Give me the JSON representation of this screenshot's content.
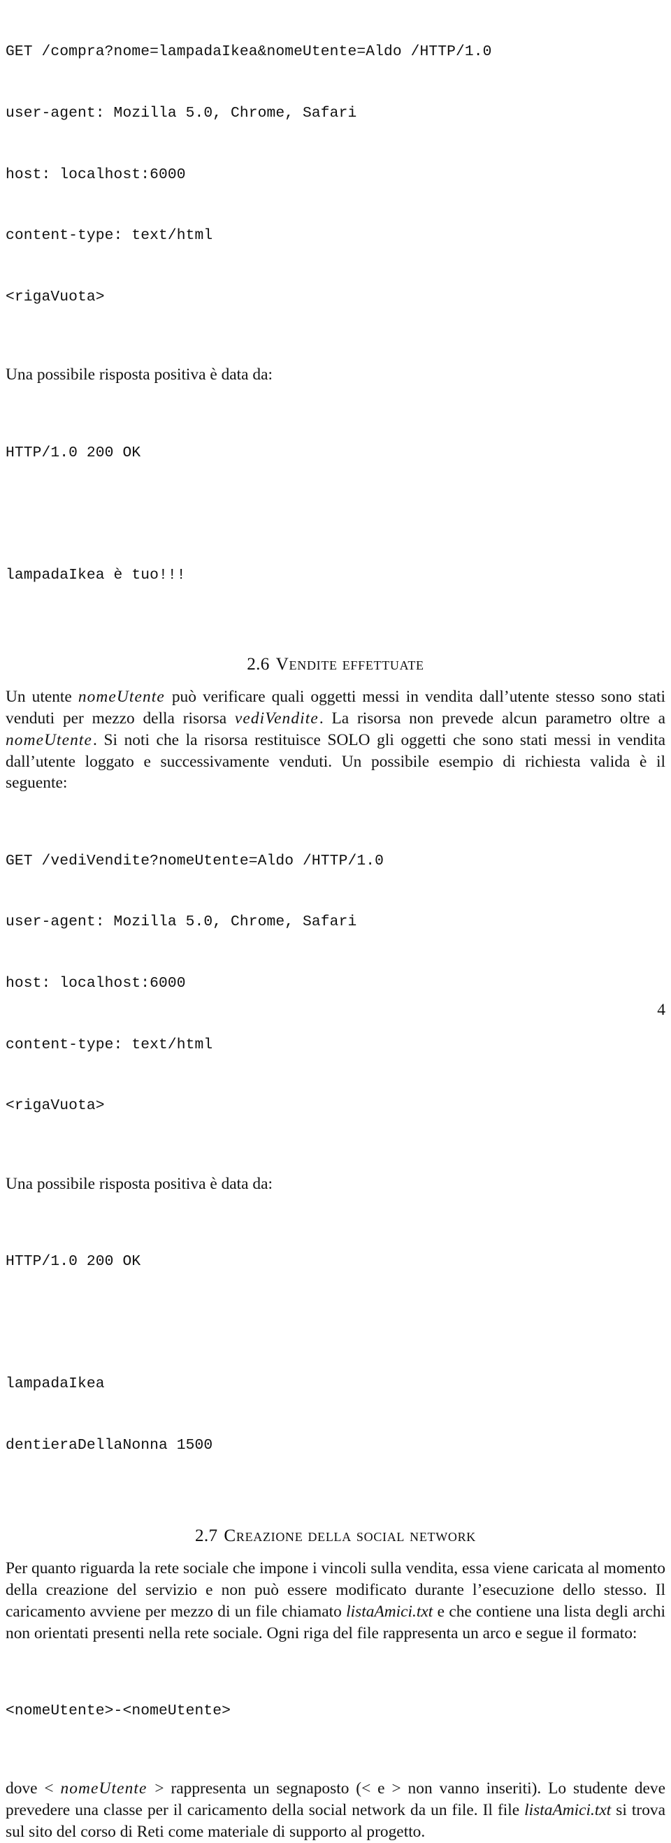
{
  "page": {
    "number": "4",
    "background_color": "#ffffff",
    "text_color": "#121212"
  },
  "blocks": {
    "request_compra": {
      "lines": [
        "GET /compra?nome=lampadaIkea&nomeUtente=Aldo /HTTP/1.0",
        "user-agent: Mozilla 5.0, Chrome, Safari",
        "host: localhost:6000",
        "content-type: text/html",
        "<rigaVuota>"
      ]
    },
    "intro_response_1": "Una possibile risposta positiva è data da:",
    "response_compra_status": "HTTP/1.0 200 OK",
    "response_compra_body": "lampadaIkea è tuo!!!",
    "request_vedivendite": {
      "lines": [
        "GET /vediVendite?nomeUtente=Aldo /HTTP/1.0",
        "user-agent: Mozilla 5.0, Chrome, Safari",
        "host: localhost:6000",
        "content-type: text/html",
        "<rigaVuota>"
      ]
    },
    "intro_response_2": "Una possibile risposta positiva è data da:",
    "response_vedivendite_status": "HTTP/1.0 200 OK",
    "response_vedivendite_body": [
      "lampadaIkea",
      "dentieraDellaNonna 1500"
    ],
    "arc_format_line": "<nomeUtente>-<nomeUtente>"
  },
  "sections": {
    "s26": {
      "number": "2.6",
      "title": "Vendite effettuate",
      "paragraph": {
        "part1": "Un utente ",
        "ital1": "nomeUtente",
        "part2": " può verificare quali oggetti messi in vendita dall’utente stesso sono stati venduti per mezzo della risorsa ",
        "ital2": "vediVendite",
        "part3": ". La risorsa non prevede alcun parametro oltre a ",
        "ital3": "nomeUtente",
        "part4": ". Si noti che la risorsa restituisce SOLO gli oggetti che sono stati messi in vendita dall’utente loggato e successivamente venduti. Un possibile esempio di richiesta valida è il seguente:"
      }
    },
    "s27": {
      "number": "2.7",
      "title": "Creazione della social network",
      "paragraph1": {
        "part1": "Per quanto riguarda la rete sociale che impone i vincoli sulla vendita, essa viene caricata al momento della creazione del servizio e non può essere modificato durante l’esecuzione dello stesso. Il caricamento avviene per mezzo di un file chiamato ",
        "ital1": "listaAmici.txt",
        "part2": " e che contiene una lista degli archi non orientati presenti nella rete sociale. Ogni riga del file rappresenta un arco e segue il formato:"
      },
      "paragraph2": {
        "part1": "dove < ",
        "ital1": "nomeUtente",
        "part2": " > rappresenta un segnaposto (< e > non vanno inseriti). Lo studente deve prevedere una classe per il caricamento della social network da un file. Il file ",
        "ital2": "listaAmici.txt",
        "part3": " si trova sul sito del corso di Reti come materiale di supporto al progetto."
      }
    }
  }
}
